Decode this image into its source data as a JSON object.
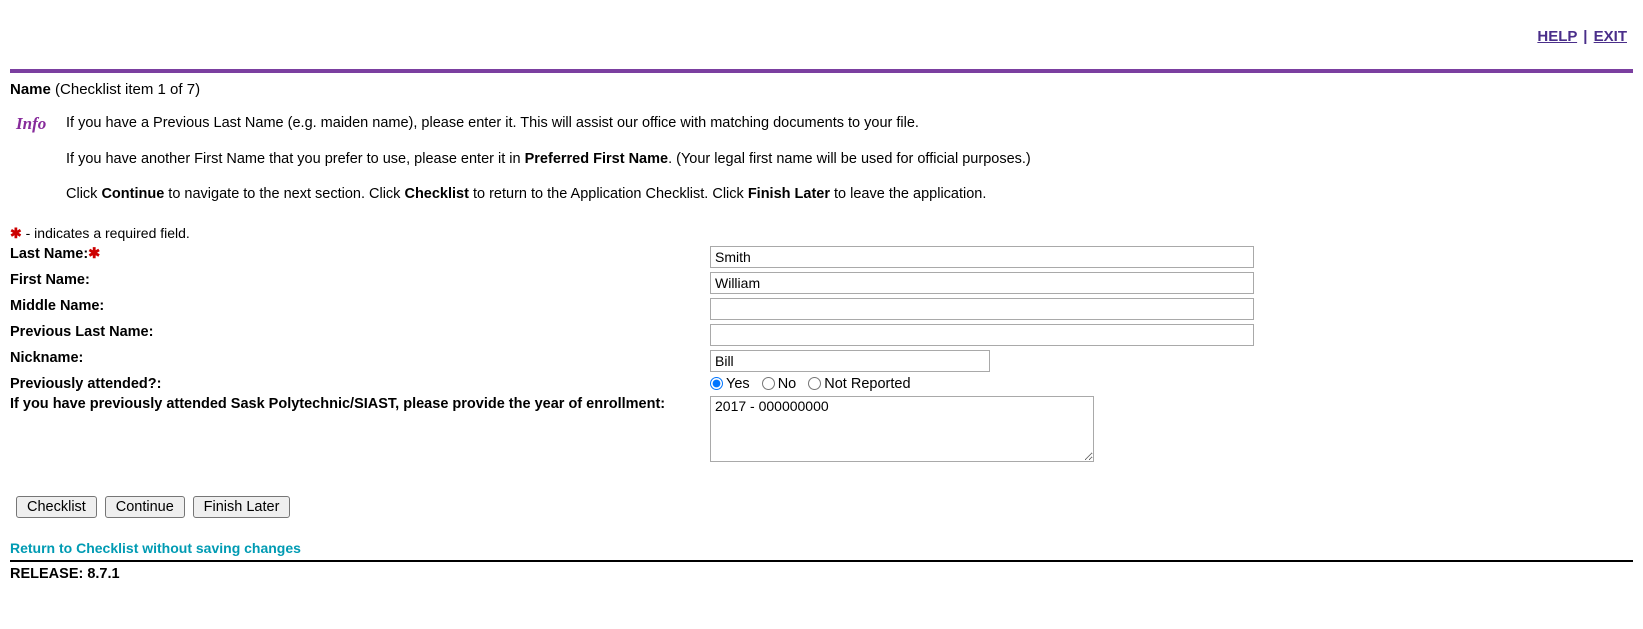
{
  "top_links": {
    "help": "HELP",
    "exit": "EXIT",
    "sep": "|"
  },
  "header": {
    "title_strong": "Name",
    "title_suffix": "(Checklist item 1 of 7)"
  },
  "info": {
    "icon_text": "Info",
    "p1_a": "If you have a Previous Last Name (e.g. maiden name), please enter it. This will assist our office with matching documents to your file.",
    "p2_a": "If you have another First Name that you prefer to use, please enter it in ",
    "p2_b": "Preferred First Name",
    "p2_c": ". (Your legal first name will be used for official purposes.)",
    "p3_a": "Click ",
    "p3_b": "Continue",
    "p3_c": " to navigate to the next section. Click ",
    "p3_d": "Checklist",
    "p3_e": " to return to the Application Checklist. Click ",
    "p3_f": "Finish Later",
    "p3_g": " to leave the application."
  },
  "required_note": " - indicates a required field.",
  "labels": {
    "last_name": "Last Name:",
    "first_name": "First Name:",
    "middle_name": "Middle Name:",
    "prev_last_name": "Previous Last Name:",
    "nickname": "Nickname:",
    "prev_attended": "Previously attended?:",
    "enroll_year": "If you have previously attended Sask Polytechnic/SIAST, please provide the year of enrollment:"
  },
  "values": {
    "last_name": "Smith",
    "first_name": "William",
    "middle_name": "",
    "prev_last_name": "",
    "nickname": "Bill",
    "enroll_year": "2017 - 000000000"
  },
  "radios": {
    "yes": "Yes",
    "no": "No",
    "not_reported": "Not Reported"
  },
  "buttons": {
    "checklist": "Checklist",
    "continue": "Continue",
    "finish_later": "Finish Later"
  },
  "footer": {
    "return_link": "Return to Checklist without saving changes",
    "release": "RELEASE: 8.7.1"
  }
}
